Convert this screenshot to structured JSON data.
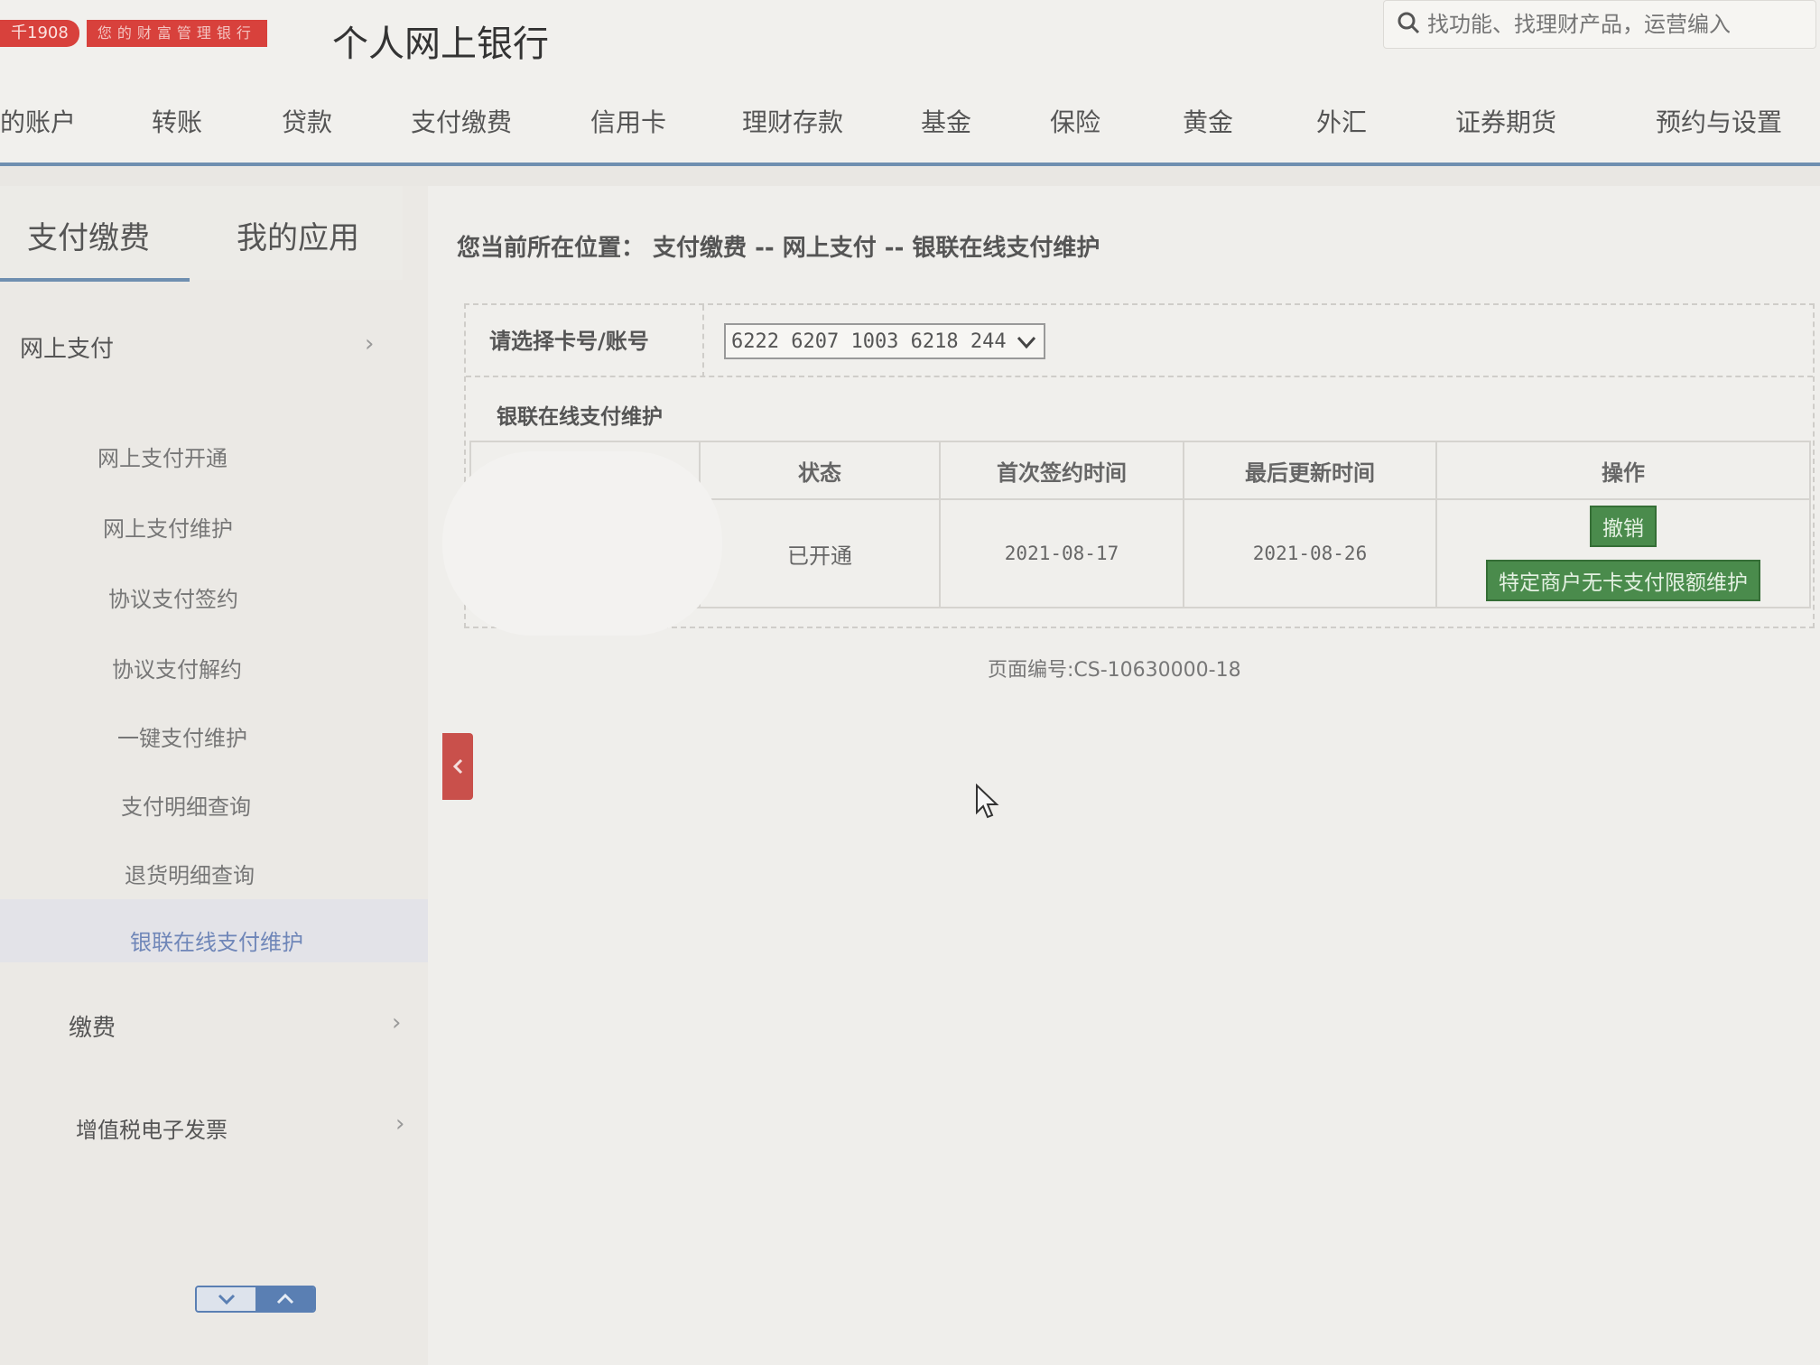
{
  "header": {
    "logo_year": "千1908",
    "logo_slogan": "您的财富管理银行",
    "title": "个人网上银行",
    "search_placeholder": "找功能、找理财产品，运营编入"
  },
  "topnav": {
    "items": [
      "的账户",
      "转账",
      "贷款",
      "支付缴费",
      "信用卡",
      "理财存款",
      "基金",
      "保险",
      "黄金",
      "外汇",
      "证券期货",
      "预约与设置"
    ]
  },
  "sidebar": {
    "tabs": [
      "支付缴费",
      "我的应用"
    ],
    "groups": {
      "online_pay": "网上支付",
      "payment": "缴费",
      "vat_invoice": "增值税电子发票"
    },
    "items": [
      "网上支付开通",
      "网上支付维护",
      "协议支付签约",
      "协议支付解约",
      "一键支付维护",
      "支付明细查询",
      "退货明细查询",
      "银联在线支付维护"
    ],
    "chevron": "›"
  },
  "main": {
    "breadcrumb": "您当前所在位置： 支付缴费 -- 网上支付 -- 银联在线支付维护",
    "select_label": "请选择卡号/账号",
    "card_number": "6222 6207 1003 6218 244",
    "section_title": "银联在线支付维护",
    "table": {
      "headers": [
        "",
        "状态",
        "首次签约时间",
        "最后更新时间",
        "操作"
      ],
      "row": {
        "status": "已开通",
        "first_signed": "2021-08-17",
        "last_updated": "2021-08-26"
      }
    },
    "actions": {
      "cancel": "撤销",
      "limit": "特定商户无卡支付限额维护"
    },
    "page_code": "页面编号:CS-10630000-18"
  },
  "colors": {
    "brand_red": "#d8413c",
    "nav_underline": "#6f8fb0",
    "action_green": "#4a8b4c",
    "active_item": "#6f86b8"
  }
}
